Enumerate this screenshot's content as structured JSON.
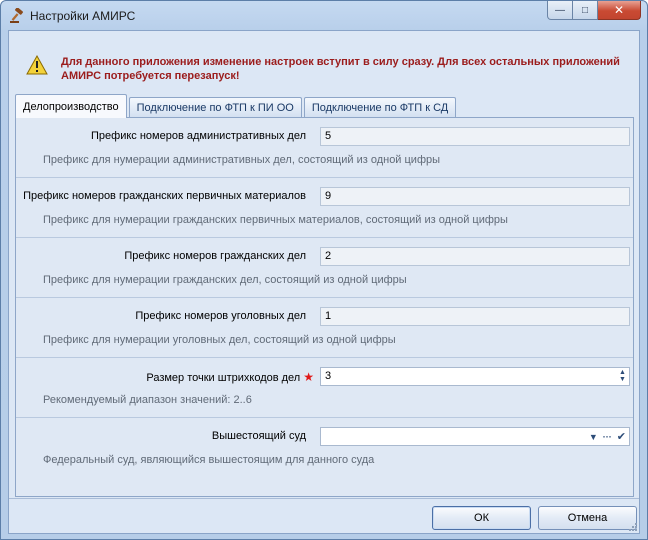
{
  "window": {
    "title": "Настройки АМИРС",
    "close_label": "✕",
    "maximize_label": "□",
    "minimize_label": "—"
  },
  "warning": {
    "text": "Для данного приложения изменение настроек вступит в силу сразу. Для всех остальных приложений АМИРС потребуется перезапуск!",
    "color": "#9b1c1c"
  },
  "tabs": [
    {
      "label": "Делопроизводство",
      "active": true
    },
    {
      "label": "Подключение по ФТП к ПИ ОО",
      "active": false
    },
    {
      "label": "Подключение по ФТП к СД",
      "active": false
    }
  ],
  "settings": [
    {
      "label": "Префикс номеров административных дел",
      "value": "5",
      "description": "Префикс для нумерации административных дел, состоящий из одной цифры"
    },
    {
      "label": "Префикс номеров гражданских первичных материалов",
      "value": "9",
      "description": "Префикс для нумерации гражданских первичных материалов, состоящий из одной цифры"
    },
    {
      "label": "Префикс номеров гражданских дел",
      "value": "2",
      "description": "Префикс для нумерации гражданских дел, состоящий из одной цифры"
    },
    {
      "label": "Префикс номеров уголовных дел",
      "value": "1",
      "description": "Префикс для нумерации уголовных дел, состоящий из одной цифры"
    },
    {
      "label": "Размер точки штрихкодов дел",
      "value": "3",
      "required_mark": "★",
      "description": "Рекомендуемый диапазон значений: 2..6"
    },
    {
      "label": "Вышестоящий суд",
      "value": "",
      "ellipsis": "···",
      "description": "Федеральный суд, являющийся вышестоящим для данного суда"
    }
  ],
  "buttons": {
    "ok": "ОК",
    "cancel": "Отмена"
  },
  "colors": {
    "accent": "#1b3a66",
    "required": "#e01818",
    "close_button": "#c94a33"
  }
}
